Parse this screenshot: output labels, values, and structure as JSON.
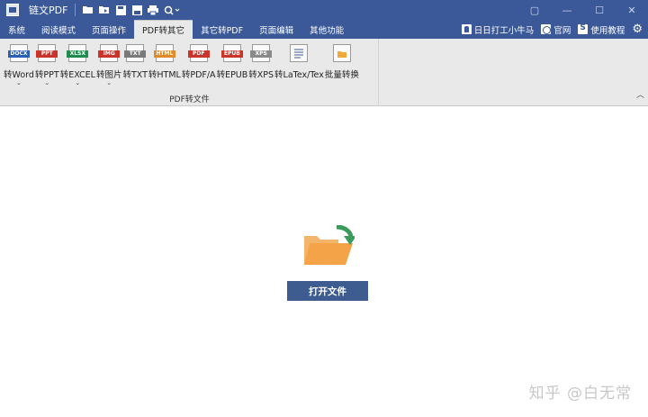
{
  "app": {
    "title": "链文PDF"
  },
  "quick_access": [
    "folder-open-icon",
    "folder-icon",
    "save-as-icon",
    "save-icon",
    "print-icon",
    "zoom-icon"
  ],
  "window": {
    "restore": "▢",
    "minimize": "—",
    "maximize": "☐",
    "close": "✕"
  },
  "tabs": [
    {
      "label": "系统"
    },
    {
      "label": "阅读模式"
    },
    {
      "label": "页面操作"
    },
    {
      "label": "PDF转其它",
      "active": true
    },
    {
      "label": "其它转PDF"
    },
    {
      "label": "页面编辑"
    },
    {
      "label": "其他功能"
    }
  ],
  "menu_right": {
    "user": "日日打工小牛马",
    "site": "官网",
    "tutorial": "使用教程"
  },
  "ribbon": {
    "group_name": "PDF转文件",
    "tools": [
      {
        "label": "转Word",
        "badge": "DOCX",
        "color": "#2b5fb4",
        "dropdown": true
      },
      {
        "label": "转PPT",
        "badge": "PPT",
        "color": "#c9352b",
        "dropdown": true
      },
      {
        "label": "转EXCEL",
        "badge": "XLSX",
        "color": "#1f8b4c",
        "dropdown": true
      },
      {
        "label": "转图片",
        "badge": "IMG",
        "color": "#c9352b",
        "dropdown": true
      },
      {
        "label": "转TXT",
        "badge": "TXT",
        "color": "#7a7a7a",
        "dropdown": false
      },
      {
        "label": "转HTML",
        "badge": "HTML",
        "color": "#e08a2b",
        "dropdown": false
      },
      {
        "label": "转PDF/A",
        "badge": "PDF",
        "color": "#c9352b",
        "dropdown": false
      },
      {
        "label": "转EPUB",
        "badge": "EPUB",
        "color": "#c9352b",
        "dropdown": false
      },
      {
        "label": "转XPS",
        "badge": "XPS",
        "color": "#8a8a8a",
        "dropdown": false
      },
      {
        "label": "转LaTex/Tex",
        "badge": "",
        "color": "#3b5998",
        "dropdown": false
      },
      {
        "label": "批量转换",
        "badge": "",
        "color": "#f0a93b",
        "dropdown": false
      }
    ]
  },
  "main": {
    "open_button": "打开文件"
  },
  "watermark": "知乎 @白无常"
}
